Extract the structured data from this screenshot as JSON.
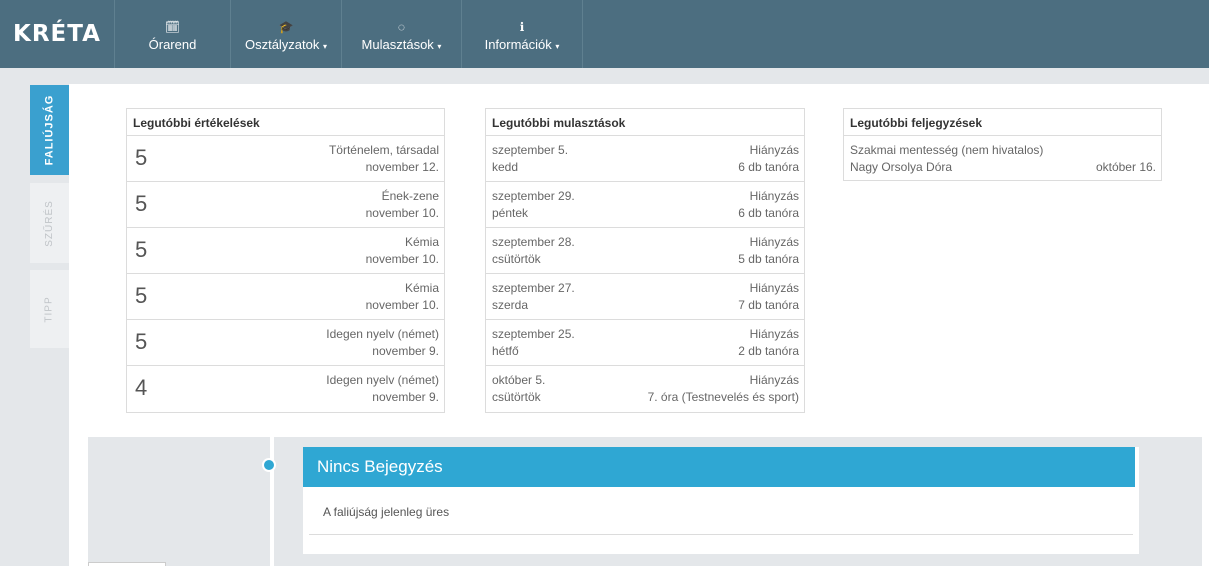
{
  "app": {
    "logo": "KRÉTA"
  },
  "nav": {
    "items": [
      {
        "label": "Órarend",
        "icon": "calendar-icon",
        "glyph": "🗓",
        "caret": ""
      },
      {
        "label": "Osztályzatok",
        "icon": "graduation-cap-icon",
        "glyph": "🎓",
        "caret": "▾"
      },
      {
        "label": "Mulasztások",
        "icon": "spinner-icon",
        "glyph": "◌",
        "caret": "▾"
      },
      {
        "label": "Információk",
        "icon": "info-icon",
        "glyph": "ℹ",
        "caret": "▾"
      }
    ]
  },
  "sidetabs": [
    "FALIÚJSÁG",
    "SZŰRÉS",
    "TIPP"
  ],
  "grades": {
    "title": "Legutóbbi értékelések",
    "rows": [
      {
        "grade": "5",
        "subject": "Történelem, társadal",
        "date": "november 12."
      },
      {
        "grade": "5",
        "subject": "Ének-zene",
        "date": "november 10."
      },
      {
        "grade": "5",
        "subject": "Kémia",
        "date": "november 10."
      },
      {
        "grade": "5",
        "subject": "Kémia",
        "date": "november 10."
      },
      {
        "grade": "5",
        "subject": "Idegen nyelv (német)",
        "date": "november 9."
      },
      {
        "grade": "4",
        "subject": "Idegen nyelv (német)",
        "date": "november 9."
      }
    ]
  },
  "absences": {
    "title": "Legutóbbi mulasztások",
    "rows": [
      {
        "date": "szeptember 5.",
        "day": "kedd",
        "type": "Hiányzás",
        "detail": "6 db tanóra"
      },
      {
        "date": "szeptember 29.",
        "day": "péntek",
        "type": "Hiányzás",
        "detail": "6 db tanóra"
      },
      {
        "date": "szeptember 28.",
        "day": "csütörtök",
        "type": "Hiányzás",
        "detail": "5 db tanóra"
      },
      {
        "date": "szeptember 27.",
        "day": "szerda",
        "type": "Hiányzás",
        "detail": "7 db tanóra"
      },
      {
        "date": "szeptember 25.",
        "day": "hétfő",
        "type": "Hiányzás",
        "detail": "2 db tanóra"
      },
      {
        "date": "október 5.",
        "day": "csütörtök",
        "type": "Hiányzás",
        "detail": "7. óra (Testnevelés és sport)"
      }
    ]
  },
  "notes": {
    "title": "Legutóbbi feljegyzések",
    "rows": [
      {
        "text": "Szakmai mentesség (nem hivatalos)",
        "author": "Nagy Orsolya Dóra",
        "date": "október 16."
      }
    ]
  },
  "timeline": {
    "title": "Nincs Bejegyzés",
    "body": "A faliújság jelenleg üres"
  }
}
